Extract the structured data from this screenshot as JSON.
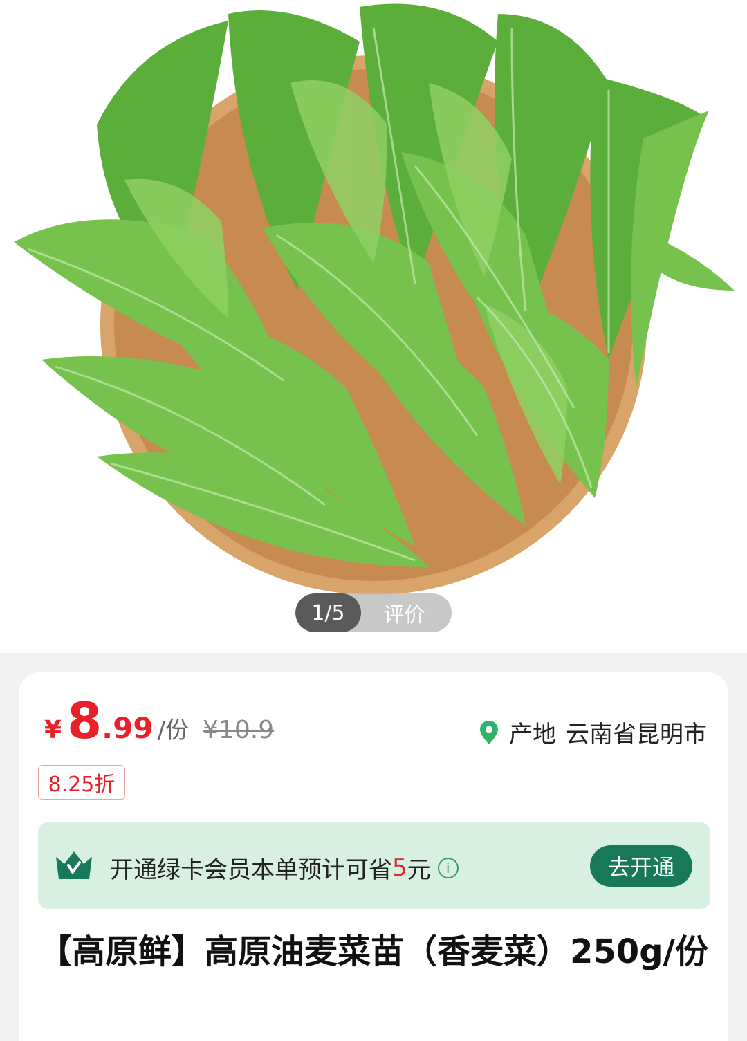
{
  "gallery": {
    "image_desc": "lettuce-product-photo",
    "pager_count": "1/5",
    "pager_review": "评价"
  },
  "price": {
    "currency": "¥",
    "integer": "8",
    "decimal": ".99",
    "unit": "/份",
    "original": "¥10.9"
  },
  "origin": {
    "label": "产地",
    "value": "云南省昆明市"
  },
  "discount_badge": "8.25折",
  "membership": {
    "text_prefix": "开通绿卡会员本单预计可省",
    "amount": "5",
    "text_suffix": "元",
    "info_icon": "i",
    "button_label": "去开通"
  },
  "product_title": "【高原鲜】高原油麦菜苗（香麦菜）250g/份",
  "colors": {
    "price": "#e8202a",
    "member_bg": "#d8f0e2",
    "member_button": "#17785a",
    "location_pin": "#2fb36b"
  }
}
